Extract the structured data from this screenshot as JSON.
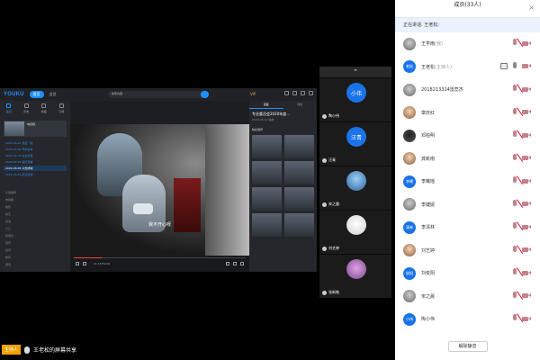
{
  "share_view": {
    "youku": {
      "logo": "YOUKU",
      "nav_items": [
        "首页",
        "会员"
      ],
      "search_text": "搜索内容",
      "vip": "VIP",
      "left_tabs": [
        "首页",
        "历史",
        "收藏",
        "订阅"
      ],
      "thumb_title": "电视剧",
      "playlist": [
        "2020-03-01 抗疫一线",
        "2020-03-02 守护生命",
        "2020-03-03 白衣天使",
        "2020-03-04 逆行英雄",
        "2020-03-05 众志成城",
        "2020-03-06 武汉加油"
      ],
      "categories": [
        "片库推荐",
        "电视剧",
        "电影",
        "综艺",
        "动漫",
        "少儿",
        "纪录片",
        "音乐",
        "资讯",
        "体育",
        "游戏",
        "生活",
        "娱乐",
        "科技"
      ],
      "subtitle": "我不开心呀",
      "time": "11:15/59:00",
      "right_tabs": [
        "选集",
        "评论"
      ],
      "right_title": "专业委员会2020年度...",
      "right_sub": "2020-03-01 播放",
      "right_head": "精彩推荐"
    }
  },
  "video_strip": {
    "tiles": [
      {
        "avatar_text": "小伟",
        "name": "陶小伟",
        "style": "blue"
      },
      {
        "avatar_text": "汪青",
        "name": "汪青",
        "style": "blue"
      },
      {
        "avatar_text": "",
        "name": "宋之晨",
        "style": "img1"
      },
      {
        "avatar_text": "",
        "name": "刘艺婷",
        "style": "img2"
      },
      {
        "avatar_text": "",
        "name": "张新皓",
        "style": "img3"
      }
    ]
  },
  "panel": {
    "title": "成员(33人)",
    "speaking": "正在讲话: 王老松;",
    "participants": [
      {
        "avatar_text": "",
        "avatar_style": "photo",
        "name": "王学雨",
        "role": "(我)",
        "mic": "muted",
        "cam": "muted",
        "screen": false
      },
      {
        "avatar_text": "老松",
        "avatar_style": "blue",
        "name": "王老松",
        "role": "(主持人)",
        "mic": "on",
        "cam": "muted",
        "screen": true
      },
      {
        "avatar_text": "",
        "avatar_style": "photo",
        "name": "2018213324雷蕊杰",
        "role": "",
        "mic": "muted",
        "cam": "muted",
        "screen": false
      },
      {
        "avatar_text": "",
        "avatar_style": "photo2",
        "name": "章庆红",
        "role": "",
        "mic": "muted",
        "cam": "muted",
        "screen": false
      },
      {
        "avatar_text": "",
        "avatar_style": "photo3",
        "name": "邓柏明",
        "role": "",
        "mic": "muted",
        "cam": "muted",
        "screen": false
      },
      {
        "avatar_text": "",
        "avatar_style": "photo2",
        "name": "龚新南",
        "role": "",
        "mic": "muted",
        "cam": "muted",
        "screen": false
      },
      {
        "avatar_text": "李曦",
        "avatar_style": "blue",
        "name": "李曦瑶",
        "role": "",
        "mic": "muted",
        "cam": "muted",
        "screen": false
      },
      {
        "avatar_text": "",
        "avatar_style": "photo",
        "name": "李婕妮",
        "role": "",
        "mic": "muted",
        "cam": "muted",
        "screen": false
      },
      {
        "avatar_text": "清林",
        "avatar_style": "blue",
        "name": "李清林",
        "role": "",
        "mic": "muted",
        "cam": "muted",
        "screen": false
      },
      {
        "avatar_text": "",
        "avatar_style": "photo2",
        "name": "刘艺婷",
        "role": "",
        "mic": "muted",
        "cam": "muted",
        "screen": false
      },
      {
        "avatar_text": "俊阳",
        "avatar_style": "blue",
        "name": "刘俊阳",
        "role": "",
        "mic": "muted",
        "cam": "muted",
        "screen": false
      },
      {
        "avatar_text": "",
        "avatar_style": "photo",
        "name": "宋之晨",
        "role": "",
        "mic": "muted",
        "cam": "muted",
        "screen": false
      },
      {
        "avatar_text": "小伟",
        "avatar_style": "blue",
        "name": "陶小伟",
        "role": "",
        "mic": "muted",
        "cam": "muted",
        "screen": false
      }
    ],
    "unmute_button": "解除静音"
  },
  "share_bar": {
    "host_badge": "主持人",
    "text": "王老松的屏幕共享"
  }
}
